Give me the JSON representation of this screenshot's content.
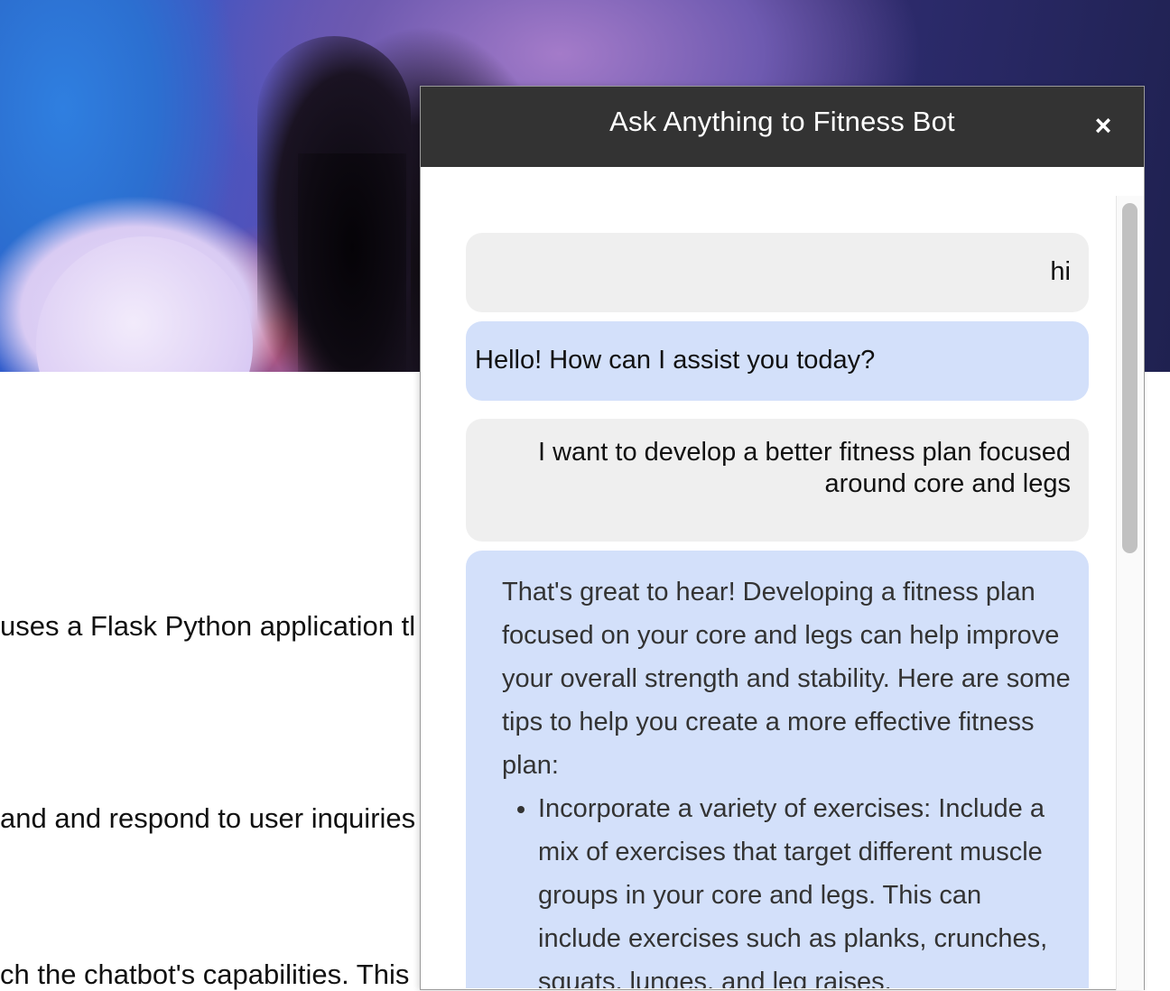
{
  "page": {
    "lines": [
      "uses a Flask Python application tl",
      "and and respond to user inquiries",
      "ch the chatbot's capabilities. This"
    ]
  },
  "chat": {
    "title": "Ask Anything to Fitness Bot",
    "close_label": "×",
    "messages": [
      {
        "role": "user",
        "text": "hi"
      },
      {
        "role": "bot",
        "text": "Hello! How can I assist you today?"
      },
      {
        "role": "user",
        "lines": [
          "I want to develop a better fitness plan focused",
          "around core and legs"
        ]
      },
      {
        "role": "bot",
        "text": "That's great to hear! Developing a fitness plan focused on your core and legs can help improve your overall strength and stability. Here are some tips to help you create a more effective fitness plan:",
        "bullets": [
          "Incorporate a variety of exercises: Include a mix of exercises that target different muscle groups in your core and legs. This can include exercises such as planks, crunches, squats, lunges, and leg raises."
        ]
      }
    ]
  }
}
